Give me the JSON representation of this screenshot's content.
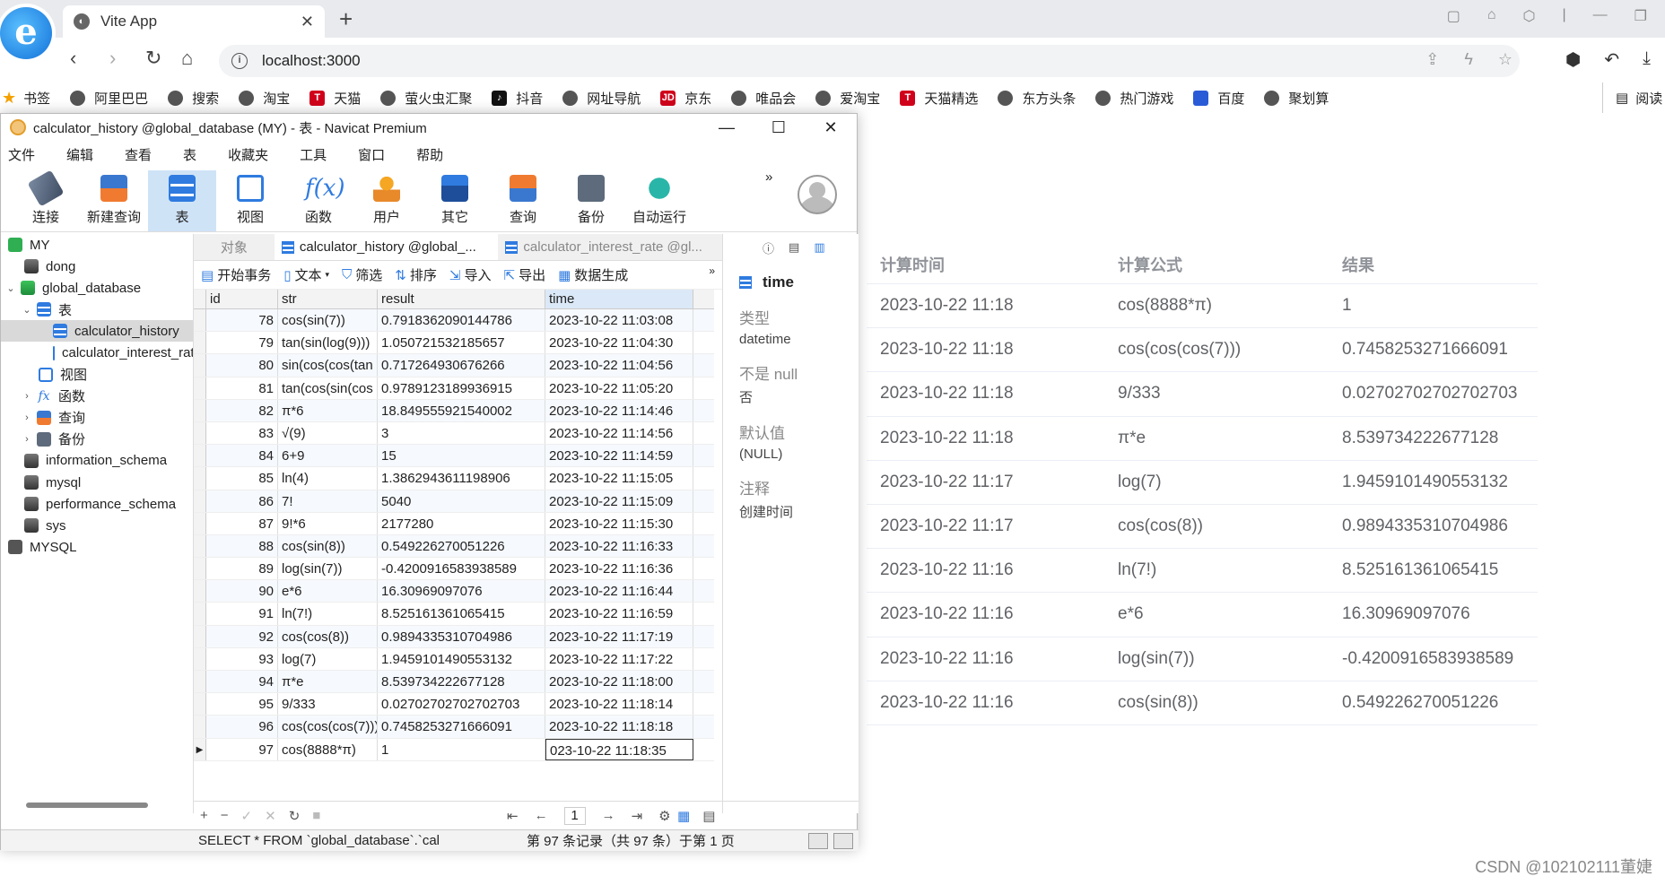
{
  "browser": {
    "tab_title": "Vite App",
    "url": "localhost:3000",
    "bookmarks": [
      "书签",
      "阿里巴巴",
      "搜索",
      "淘宝",
      "天猫",
      "萤火虫汇聚",
      "抖音",
      "网址导航",
      "京东",
      "唯品会",
      "爱淘宝",
      "天猫精选",
      "东方头条",
      "热门游戏",
      "百度",
      "聚划算"
    ],
    "reading_mode": "阅读"
  },
  "webpage": {
    "headers": {
      "time": "计算时间",
      "formula": "计算公式",
      "result": "结果"
    },
    "rows": [
      {
        "time": "2023-10-22 11:18",
        "formula": "cos(8888*π)",
        "result": "1"
      },
      {
        "time": "2023-10-22 11:18",
        "formula": "cos(cos(cos(7)))",
        "result": "0.7458253271666091"
      },
      {
        "time": "2023-10-22 11:18",
        "formula": "9/333",
        "result": "0.02702702702702703"
      },
      {
        "time": "2023-10-22 11:18",
        "formula": "π*e",
        "result": "8.539734222677128"
      },
      {
        "time": "2023-10-22 11:17",
        "formula": "log(7)",
        "result": "1.9459101490553132"
      },
      {
        "time": "2023-10-22 11:17",
        "formula": "cos(cos(8))",
        "result": "0.9894335310704986"
      },
      {
        "time": "2023-10-22 11:16",
        "formula": "ln(7!)",
        "result": "8.525161361065415"
      },
      {
        "time": "2023-10-22 11:16",
        "formula": "e*6",
        "result": "16.30969097076"
      },
      {
        "time": "2023-10-22 11:16",
        "formula": "log(sin(7))",
        "result": "-0.4200916583938589"
      },
      {
        "time": "2023-10-22 11:16",
        "formula": "cos(sin(8))",
        "result": "0.549226270051226"
      }
    ],
    "watermark": "CSDN @102102111董婕"
  },
  "navicat": {
    "title": "calculator_history @global_database (MY) - 表 - Navicat Premium",
    "menu": [
      "文件",
      "编辑",
      "查看",
      "表",
      "收藏夹",
      "工具",
      "窗口",
      "帮助"
    ],
    "ribbon": [
      "连接",
      "新建查询",
      "表",
      "视图",
      "函数",
      "用户",
      "其它",
      "查询",
      "备份",
      "自动运行"
    ],
    "tree": [
      {
        "label": "MY",
        "indent": 0,
        "arrow": "",
        "icon": "conn"
      },
      {
        "label": "dong",
        "indent": 1,
        "arrow": "",
        "icon": "db"
      },
      {
        "label": "global_database",
        "indent": 0,
        "arrow": "⌄",
        "icon": "db-open"
      },
      {
        "label": "表",
        "indent": 1,
        "arrow": "⌄",
        "icon": "tbl"
      },
      {
        "label": "calculator_history",
        "indent": 2,
        "arrow": "",
        "icon": "tbl",
        "selected": true
      },
      {
        "label": "calculator_interest_rate",
        "indent": 2,
        "arrow": "",
        "icon": "tbl"
      },
      {
        "label": "视图",
        "indent": 1,
        "arrow": "",
        "icon": "view"
      },
      {
        "label": "函数",
        "indent": 1,
        "arrow": "›",
        "icon": "fx"
      },
      {
        "label": "查询",
        "indent": 1,
        "arrow": "›",
        "icon": "qry"
      },
      {
        "label": "备份",
        "indent": 1,
        "arrow": "›",
        "icon": "bak"
      },
      {
        "label": "information_schema",
        "indent": 1,
        "arrow": "",
        "icon": "db"
      },
      {
        "label": "mysql",
        "indent": 1,
        "arrow": "",
        "icon": "db"
      },
      {
        "label": "performance_schema",
        "indent": 1,
        "arrow": "",
        "icon": "db"
      },
      {
        "label": "sys",
        "indent": 1,
        "arrow": "",
        "icon": "db"
      },
      {
        "label": "MYSQL",
        "indent": 0,
        "arrow": "",
        "icon": "mysql"
      }
    ],
    "tabs": {
      "objects": "对象",
      "active": "calculator_history @global_...",
      "inactive": "calculator_interest_rate @gl..."
    },
    "actions": [
      "开始事务",
      "文本",
      "筛选",
      "排序",
      "导入",
      "导出",
      "数据生成"
    ],
    "columns": [
      "id",
      "str",
      "result",
      "time"
    ],
    "rows": [
      {
        "id": "78",
        "str": "cos(sin(7))",
        "result": "0.7918362090144786",
        "time": "2023-10-22 11:03:08"
      },
      {
        "id": "79",
        "str": "tan(sin(log(9)))",
        "result": "1.050721532185657",
        "time": "2023-10-22 11:04:30"
      },
      {
        "id": "80",
        "str": "sin(cos(cos(tan",
        "result": "0.717264930676266",
        "time": "2023-10-22 11:04:56"
      },
      {
        "id": "81",
        "str": "tan(cos(sin(cos",
        "result": "0.9789123189936915",
        "time": "2023-10-22 11:05:20"
      },
      {
        "id": "82",
        "str": "π*6",
        "result": "18.849555921540002",
        "time": "2023-10-22 11:14:46"
      },
      {
        "id": "83",
        "str": "√(9)",
        "result": "3",
        "time": "2023-10-22 11:14:56"
      },
      {
        "id": "84",
        "str": "6+9",
        "result": "15",
        "time": "2023-10-22 11:14:59"
      },
      {
        "id": "85",
        "str": "ln(4)",
        "result": "1.3862943611198906",
        "time": "2023-10-22 11:15:05"
      },
      {
        "id": "86",
        "str": "7!",
        "result": "5040",
        "time": "2023-10-22 11:15:09"
      },
      {
        "id": "87",
        "str": "9!*6",
        "result": "2177280",
        "time": "2023-10-22 11:15:30"
      },
      {
        "id": "88",
        "str": "cos(sin(8))",
        "result": "0.549226270051226",
        "time": "2023-10-22 11:16:33"
      },
      {
        "id": "89",
        "str": "log(sin(7))",
        "result": "-0.4200916583938589",
        "time": "2023-10-22 11:16:36"
      },
      {
        "id": "90",
        "str": "e*6",
        "result": "16.30969097076",
        "time": "2023-10-22 11:16:44"
      },
      {
        "id": "91",
        "str": "ln(7!)",
        "result": "8.525161361065415",
        "time": "2023-10-22 11:16:59"
      },
      {
        "id": "92",
        "str": "cos(cos(8))",
        "result": "0.9894335310704986",
        "time": "2023-10-22 11:17:19"
      },
      {
        "id": "93",
        "str": "log(7)",
        "result": "1.9459101490553132",
        "time": "2023-10-22 11:17:22"
      },
      {
        "id": "94",
        "str": "π*e",
        "result": "8.539734222677128",
        "time": "2023-10-22 11:18:00"
      },
      {
        "id": "95",
        "str": "9/333",
        "result": "0.02702702702702703",
        "time": "2023-10-22 11:18:14"
      },
      {
        "id": "96",
        "str": "cos(cos(cos(7)))",
        "result": "0.7458253271666091",
        "time": "2023-10-22 11:18:18"
      },
      {
        "id": "97",
        "str": "cos(8888*π)",
        "result": "1",
        "time": "023-10-22 11:18:35",
        "current": true
      }
    ],
    "properties": {
      "field": "time",
      "type_label": "类型",
      "type_value": "datetime",
      "null_label": "不是 null",
      "null_value": "否",
      "default_label": "默认值",
      "default_value": "(NULL)",
      "comment_label": "注释",
      "comment_value": "创建时间"
    },
    "page_number": "1",
    "status_sql": "SELECT * FROM `global_database`.`cal",
    "status_records": "第 97 条记录（共 97 条）于第 1 页"
  }
}
